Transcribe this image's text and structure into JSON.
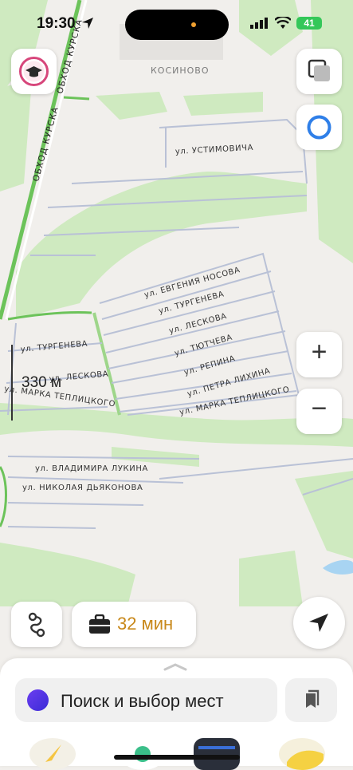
{
  "status_bar": {
    "time": "19:30",
    "battery": "41"
  },
  "map": {
    "district": "КОСИНОВО",
    "roads": [
      "ОБХОД КУРСКА",
      "ОБХОД КУРСКА"
    ],
    "streets": [
      "ул. УСТИМОВИЧА",
      "ул. ЕВГЕНИЯ НОСОВА",
      "ул. ТУРГЕНЕВА",
      "ул. ЛЕСКОВА",
      "ул. ТЮТЧЕВА",
      "ул. РЕПИНА",
      "ул. ПЕТРА ЛИХИНА",
      "ул. МАРКА ТЕПЛИЦКОГО",
      "ул. ТУРГЕНЕВА",
      "ул. ЛЕСКОВА",
      "ул. МАРКА ТЕПЛИЦКОГО",
      "ул. ВЛАДИМИРА ЛУКИНА",
      "ул. НИКОЛАЯ ДЬЯКОНОВА"
    ],
    "scale": "330 м",
    "zoom_in": "+",
    "zoom_out": "−"
  },
  "route": {
    "eta": "32 мин"
  },
  "sheet": {
    "search_placeholder": "Поиск и выбор мест"
  }
}
